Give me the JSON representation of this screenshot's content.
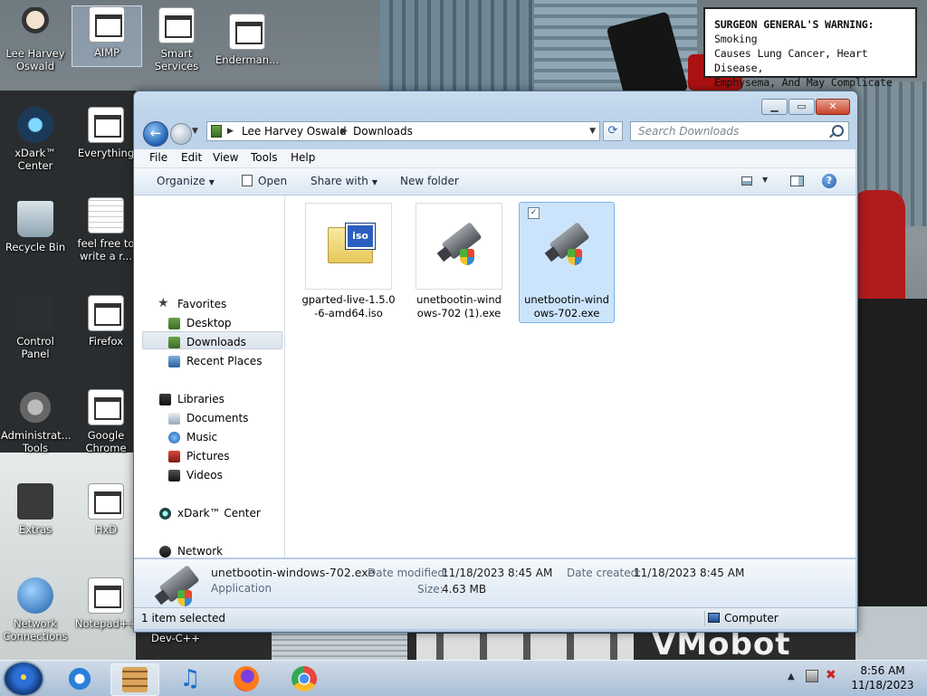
{
  "warning": {
    "bold": "SURGEON GENERAL'S WARNING:",
    "line1": "Smoking",
    "line2": "Causes Lung Cancer, Heart Disease,",
    "line3": "Emphysema, And May Complicate Pregnancy."
  },
  "wallpaper_text": "VMobot",
  "desktop_icons": [
    {
      "label": "Lee Harvey Oswald",
      "icon": "user-folder-icon"
    },
    {
      "label": "AIMP",
      "icon": "aimp-icon"
    },
    {
      "label": "Smart Services",
      "icon": "gear-icon"
    },
    {
      "label": "Enderman...",
      "icon": "shortcut-icon"
    },
    {
      "label": "xDark™ Center",
      "icon": "xdark-icon"
    },
    {
      "label": "Everything",
      "icon": "everything-icon"
    },
    {
      "label": "Recycle Bin",
      "icon": "recycle-bin-icon"
    },
    {
      "label": "feel free to write a r...",
      "icon": "text-document-icon"
    },
    {
      "label": "Control Panel",
      "icon": "control-panel-icon"
    },
    {
      "label": "Firefox",
      "icon": "firefox-icon"
    },
    {
      "label": "Administrat... Tools",
      "icon": "admin-tools-icon"
    },
    {
      "label": "Google Chrome",
      "icon": "chrome-icon"
    },
    {
      "label": "Extras",
      "icon": "folder-icon"
    },
    {
      "label": "HxD",
      "icon": "hxd-icon"
    },
    {
      "label": "Network Connections",
      "icon": "network-icon"
    },
    {
      "label": "Notepad++",
      "icon": "notepad-icon"
    },
    {
      "label": "Dev-C++",
      "icon": "devcpp-icon"
    }
  ],
  "explorer": {
    "address": [
      "Lee Harvey Oswald",
      "Downloads"
    ],
    "search_placeholder": "Search Downloads",
    "menu": [
      "File",
      "Edit",
      "View",
      "Tools",
      "Help"
    ],
    "commands": {
      "organize": "Organize",
      "open": "Open",
      "share": "Share with",
      "new_folder": "New folder"
    },
    "nav": {
      "favorites": "Favorites",
      "desktop": "Desktop",
      "downloads": "Downloads",
      "recent": "Recent Places",
      "libraries": "Libraries",
      "documents": "Documents",
      "music": "Music",
      "pictures": "Pictures",
      "videos": "Videos",
      "xdark": "xDark™ Center",
      "network": "Network"
    },
    "files": [
      {
        "name": "gparted-live-1.5.0-6-amd64.iso",
        "line1": "gparted-live-1.5.0",
        "line2": "-6-amd64.iso",
        "selected": false
      },
      {
        "name": "unetbootin-windows-702 (1).exe",
        "line1": "unetbootin-wind",
        "line2": "ows-702 (1).exe",
        "selected": false
      },
      {
        "name": "unetbootin-windows-702.exe",
        "line1": "unetbootin-wind",
        "line2": "ows-702.exe",
        "selected": true
      }
    ],
    "details": {
      "name": "unetbootin-windows-702.exe",
      "type": "Application",
      "date_modified_label": "Date modified:",
      "date_modified": "11/18/2023 8:45 AM",
      "date_created_label": "Date created:",
      "date_created": "11/18/2023 8:45 AM",
      "size_label": "Size:",
      "size": "4.63 MB"
    },
    "status": {
      "selection": "1 item selected",
      "zone": "Computer"
    }
  },
  "taskbar": {
    "time": "8:56 AM",
    "date": "11/18/2023"
  }
}
